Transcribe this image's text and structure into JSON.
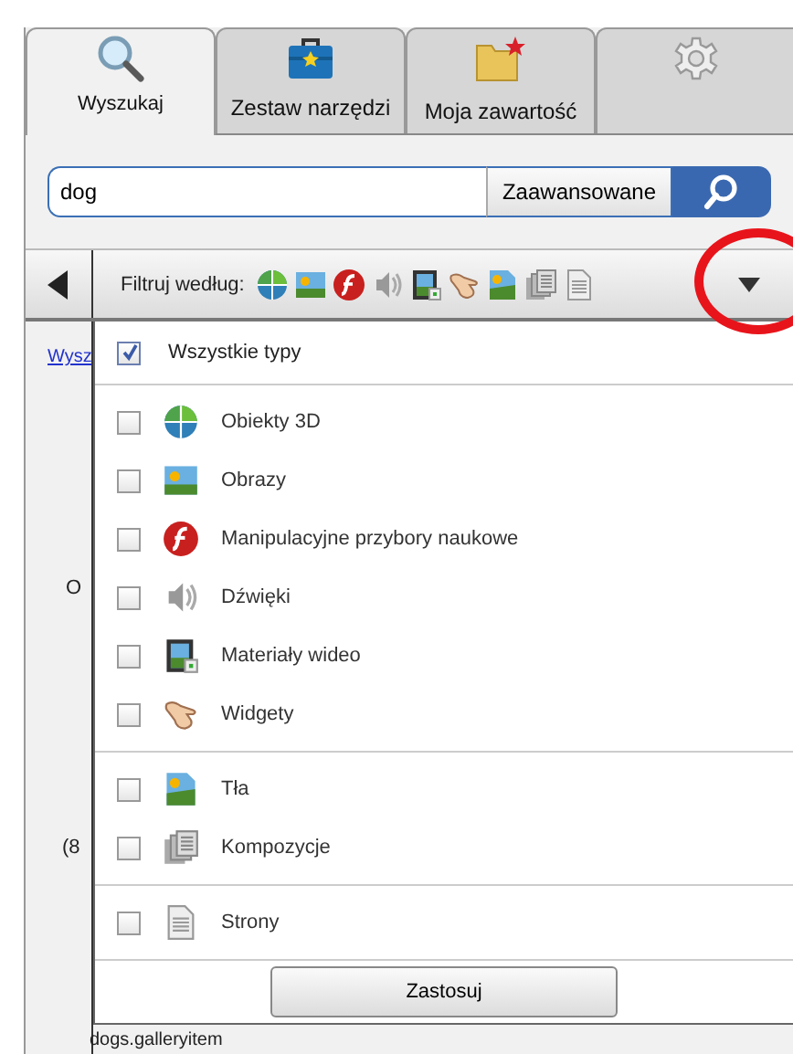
{
  "tabs": [
    {
      "label": "Wyszukaj",
      "kind": "search",
      "selected": true
    },
    {
      "label": "Zestaw narzędzi",
      "kind": "toolbox",
      "selected": false
    },
    {
      "label": "Moja zawartość",
      "kind": "folder",
      "selected": false
    },
    {
      "kind": "gear",
      "selected": false
    }
  ],
  "search": {
    "value": "dog",
    "advanced_button": "Zaawansowane"
  },
  "filter_bar": {
    "label": "Filtruj według:",
    "icons": [
      {
        "kind": "globe"
      },
      {
        "kind": "picture"
      },
      {
        "kind": "flash"
      },
      {
        "kind": "speaker"
      },
      {
        "kind": "film"
      },
      {
        "kind": "hand"
      },
      {
        "kind": "background"
      },
      {
        "kind": "pages"
      },
      {
        "kind": "page"
      }
    ]
  },
  "background": {
    "link": "Wysz",
    "fragments": [
      "O",
      "(8"
    ],
    "bottom_text": "dogs.galleryitem"
  },
  "dropdown": {
    "all_types": {
      "label": "Wszystkie typy",
      "checked": true
    },
    "groups": [
      [
        {
          "label": "Obiekty 3D",
          "kind": "globe",
          "checked": false
        },
        {
          "label": "Obrazy",
          "kind": "picture",
          "checked": false
        },
        {
          "label": "Manipulacyjne przybory naukowe",
          "kind": "flash",
          "checked": false
        },
        {
          "label": "Dźwięki",
          "kind": "speaker",
          "checked": false
        },
        {
          "label": "Materiały wideo",
          "kind": "film",
          "checked": false
        },
        {
          "label": "Widgety",
          "kind": "hand",
          "checked": false
        }
      ],
      [
        {
          "label": "Tła",
          "kind": "background",
          "checked": false
        },
        {
          "label": "Kompozycje",
          "kind": "pages",
          "checked": false
        }
      ],
      [
        {
          "label": "Strony",
          "kind": "page",
          "checked": false
        }
      ]
    ],
    "apply_button": "Zastosuj"
  }
}
